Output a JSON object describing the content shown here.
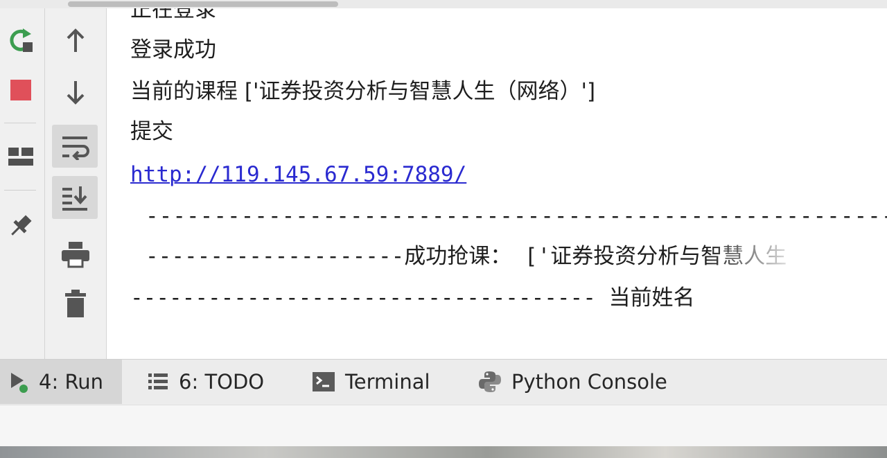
{
  "console": {
    "lines": [
      "正在登录",
      "登录成功",
      "当前的课程 ['证券投资分析与智慧人生（网络）']",
      "提交",
      "http://119.145.67.59:7889/",
      "--------------------------------------------------------------------",
      "--------------------成功抢课： ['证券投资分析与智慧人生",
      "------------------------------------ 当前姓名"
    ]
  },
  "toolbar_left": {
    "icons": [
      "rerun-icon",
      "stop-icon",
      "layout-icon",
      "pin-icon"
    ]
  },
  "toolbar_right": {
    "icons": [
      "up-arrow-icon",
      "down-arrow-icon",
      "soft-wrap-icon",
      "scroll-to-end-icon",
      "print-icon",
      "trash-icon"
    ]
  },
  "bottom_tabs": {
    "run": {
      "label": "4: Run",
      "active": true
    },
    "todo": {
      "label": "6: TODO"
    },
    "terminal": {
      "label": "Terminal"
    },
    "python_console": {
      "label": "Python Console"
    }
  },
  "colors": {
    "link": "#2a2ad0",
    "rerun_green": "#3c9d4f",
    "stop_red": "#e0505a"
  }
}
